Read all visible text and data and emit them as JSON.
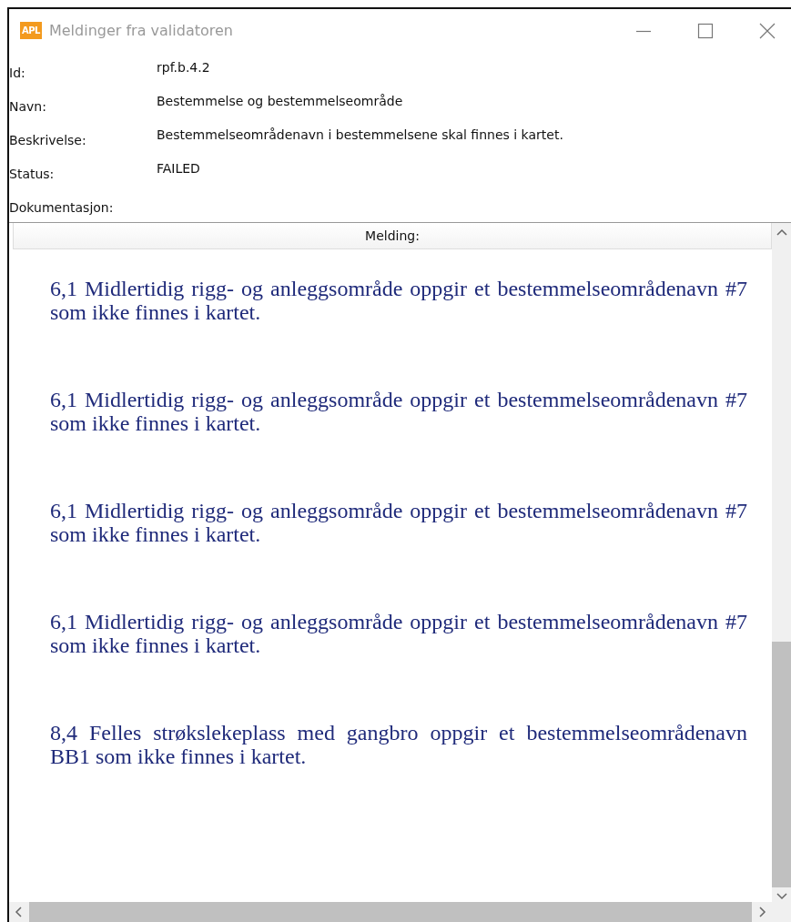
{
  "window": {
    "logo": "APL",
    "title": "Meldinger fra validatoren"
  },
  "fields": [
    {
      "label": "Id:",
      "value": "rpf.b.4.2"
    },
    {
      "label": "Navn:",
      "value": "Bestemmelse og bestemmelseområde"
    },
    {
      "label": "Beskrivelse:",
      "value": "Bestemmelseområdenavn i bestemmelsene skal finnes i kartet."
    },
    {
      "label": "Status:",
      "value": "FAILED"
    },
    {
      "label": "Dokumentasjon:"
    }
  ],
  "messages_header": "Melding:",
  "messages": [
    "6,1 Midlertidig rigg- og anleggsområde oppgir et bestemmelseområdenavn #7 som ikke finnes i kartet.",
    "6,1 Midlertidig rigg- og anleggsområde oppgir et bestemmelseområdenavn #7 som ikke finnes i kartet.",
    "6,1 Midlertidig rigg- og anleggsområde oppgir et bestemmelseområdenavn #7 som ikke finnes i kartet.",
    "6,1 Midlertidig rigg- og anleggsområde oppgir et bestemmelseområdenavn #7 som ikke finnes i kartet.",
    "8,4 Felles strøkslekeplass med gangbro oppgir et bestemmelseområdenavn BB1 som ikke finnes i kartet."
  ]
}
